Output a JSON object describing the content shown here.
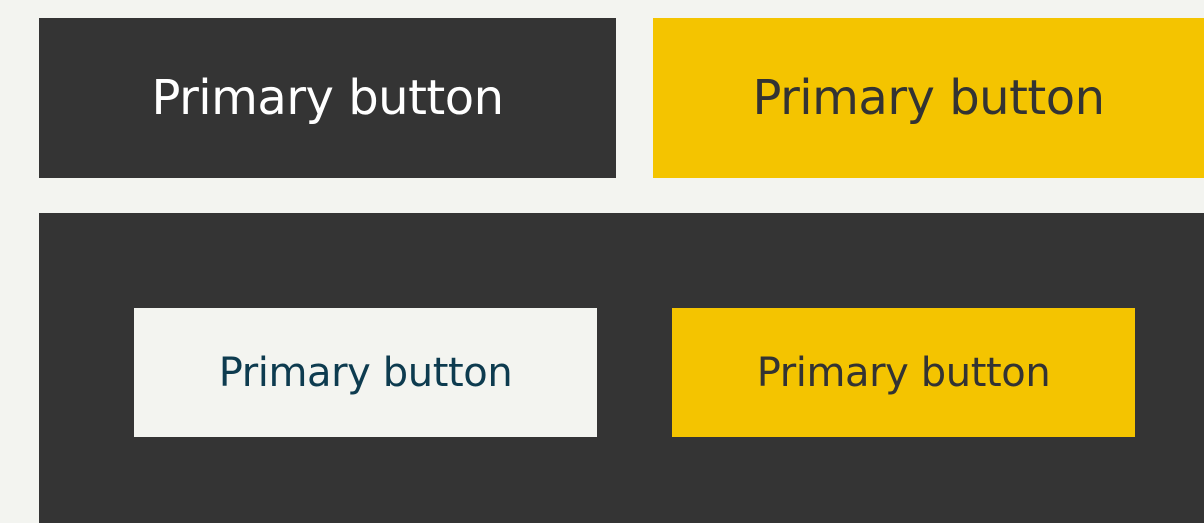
{
  "colors": {
    "page_background": "#f3f4f0",
    "dark": "#343434",
    "yellow": "#f4c400",
    "light": "#f3f4f0",
    "text_light": "#ffffff",
    "text_dark": "#333333",
    "text_navy": "#0d3b4f"
  },
  "top_row": {
    "dark_button": {
      "label": "Primary button"
    },
    "yellow_button": {
      "label": "Primary button"
    }
  },
  "dark_panel": {
    "light_button": {
      "label": "Primary button"
    },
    "yellow_button": {
      "label": "Primary button"
    }
  }
}
